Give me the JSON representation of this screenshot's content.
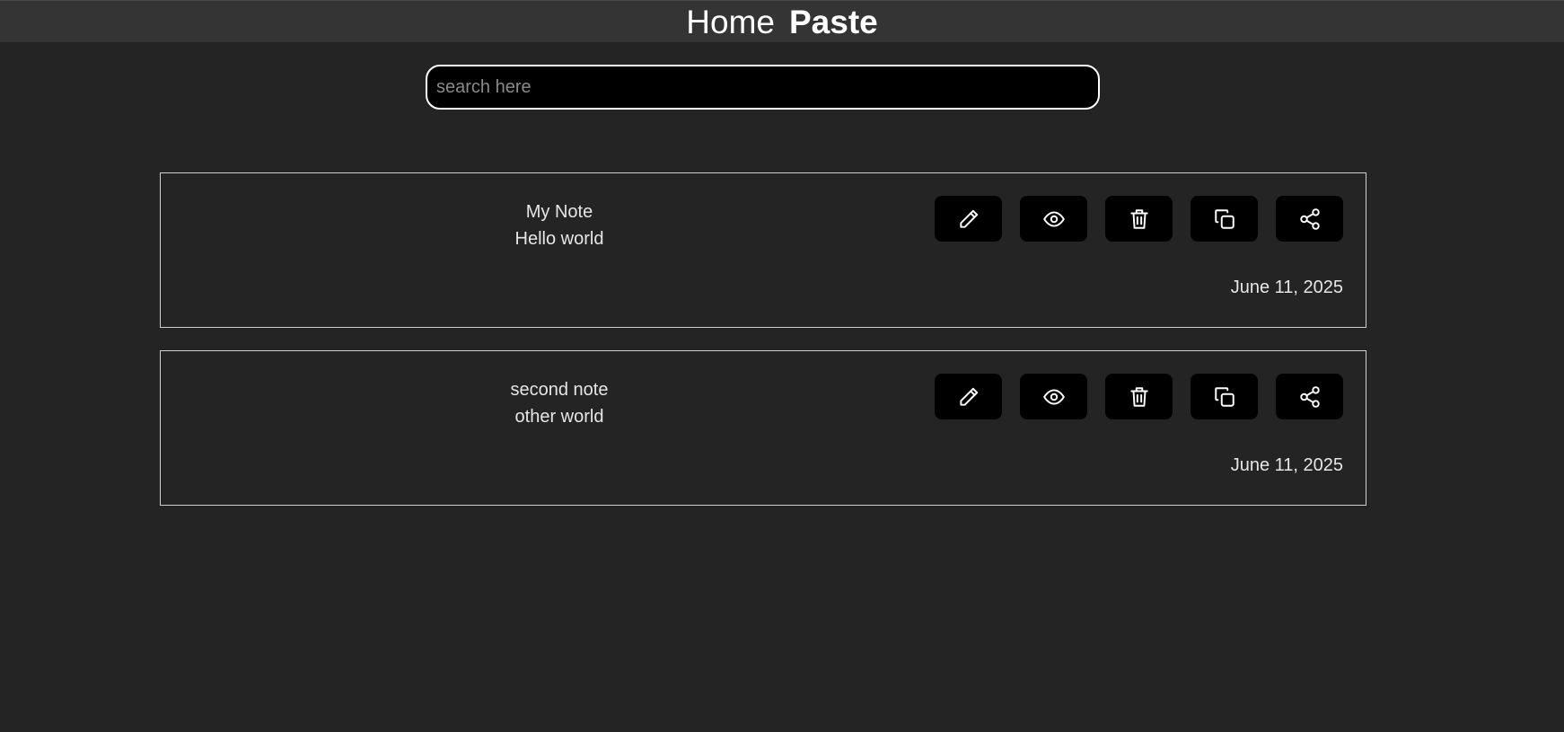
{
  "nav": {
    "home_label": "Home",
    "paste_label": "Paste"
  },
  "search": {
    "placeholder": "search here",
    "value": ""
  },
  "notes": [
    {
      "title": "My Note",
      "content": "Hello world",
      "date": "June 11, 2025"
    },
    {
      "title": "second note",
      "content": "other world",
      "date": "June 11, 2025"
    }
  ],
  "actions": [
    {
      "name": "edit",
      "icon": "pencil-icon"
    },
    {
      "name": "view",
      "icon": "eye-icon"
    },
    {
      "name": "delete",
      "icon": "trash-icon"
    },
    {
      "name": "copy",
      "icon": "copy-icon"
    },
    {
      "name": "share",
      "icon": "share-icon"
    }
  ],
  "colors": {
    "background": "#242424",
    "topbar": "#343434",
    "button": "#000000",
    "border": "#cfcfcf",
    "text": "#e6e6e6"
  }
}
